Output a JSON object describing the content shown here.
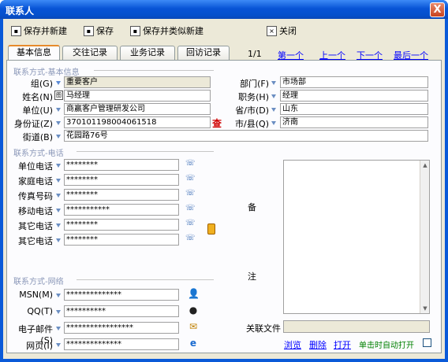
{
  "window": {
    "title": "联系人",
    "close_glyph": "X"
  },
  "toolbar": {
    "save_new": "保存并新建",
    "save": "保存",
    "save_similar": "保存并类似新建",
    "close": "关闭"
  },
  "tabs": [
    "基本信息",
    "交往记录",
    "业务记录",
    "回访记录"
  ],
  "pager": {
    "position": "1/1",
    "first": "第一个",
    "prev": "上一个",
    "next": "下一个",
    "last": "最后一个"
  },
  "groups": {
    "basic": "联系方式-基本信息",
    "phone": "联系方式-电话",
    "network": "联系方式-网络"
  },
  "basic": {
    "group_label": "组(G)",
    "group_value": "重要客户",
    "name_label": "姓名(N)",
    "name_value": "马经理",
    "unit_label": "单位(U)",
    "unit_value": "商赢客户管理研发公司",
    "idcard_label": "身份证(Z)",
    "idcard_value": "370101198004061518",
    "idcard_lookup": "查",
    "street_label": "街道(B)",
    "street_value": "花园路76号",
    "dept_label": "部门(F)",
    "dept_value": "市场部",
    "title_label": "职务(H)",
    "title_value": "经理",
    "province_label": "省/市(D)",
    "province_value": "山东",
    "city_label": "市/县(Q)",
    "city_value": "济南"
  },
  "phones": [
    {
      "label": "单位电话",
      "value": "********"
    },
    {
      "label": "家庭电话",
      "value": "********"
    },
    {
      "label": "传真号码",
      "value": "********"
    },
    {
      "label": "移动电话",
      "value": "***********"
    },
    {
      "label": "其它电话",
      "value": "********"
    },
    {
      "label": "其它电话",
      "value": "********"
    }
  ],
  "network": [
    {
      "label": "MSN(M)",
      "value": "**************"
    },
    {
      "label": "QQ(T)",
      "value": "**********"
    },
    {
      "label": "电子邮件(S)",
      "value": "*****************"
    },
    {
      "label": "网页(I)",
      "value": "**************"
    }
  ],
  "remarks": {
    "char1": "备",
    "char2": "注"
  },
  "attachment": {
    "label": "关联文件",
    "browse": "浏览",
    "delete": "删除",
    "open": "打开",
    "auto_open": "单击时自动打开"
  }
}
